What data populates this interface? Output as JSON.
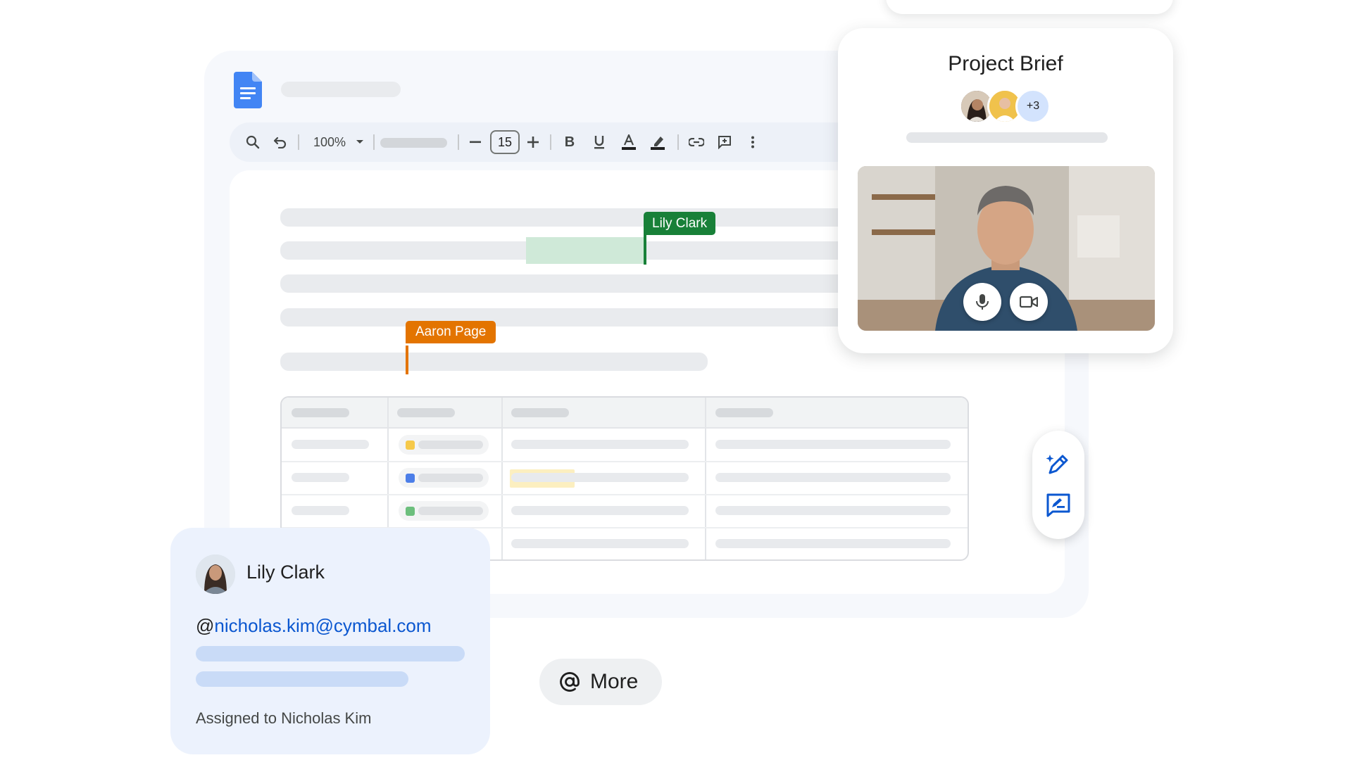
{
  "toolbar": {
    "zoom": "100%",
    "font_size": "15",
    "icons": [
      "search-icon",
      "undo-icon",
      "dropdown-icon",
      "minus-icon",
      "plus-icon",
      "bold-icon",
      "underline-icon",
      "text-color-icon",
      "highlight-icon",
      "link-icon",
      "add-comment-icon",
      "more-vert-icon"
    ]
  },
  "collaborators": {
    "lily_tag": "Lily Clark",
    "aaron_tag": "Aaron Page",
    "lily_color": "#188038",
    "aaron_color": "#e37400"
  },
  "meeting": {
    "title": "Project Brief",
    "more_participants": "+3",
    "controls": [
      "mic-icon",
      "camera-icon"
    ]
  },
  "mention": {
    "name": "Lily Clark",
    "at_symbol": "@",
    "email": "nicholas.kim@cymbal.com",
    "assigned": "Assigned to Nicholas Kim"
  },
  "more_button": {
    "label": "More"
  },
  "ai_panel": {
    "icons": [
      "magic-pen-icon",
      "help-me-write-icon"
    ]
  },
  "table": {
    "status_colors": [
      "#f6c94a",
      "#4c7ee8",
      "#6cbf7d"
    ]
  },
  "colors": {
    "accent_blue": "#0b57d0",
    "docs_blue": "#4285f4"
  }
}
